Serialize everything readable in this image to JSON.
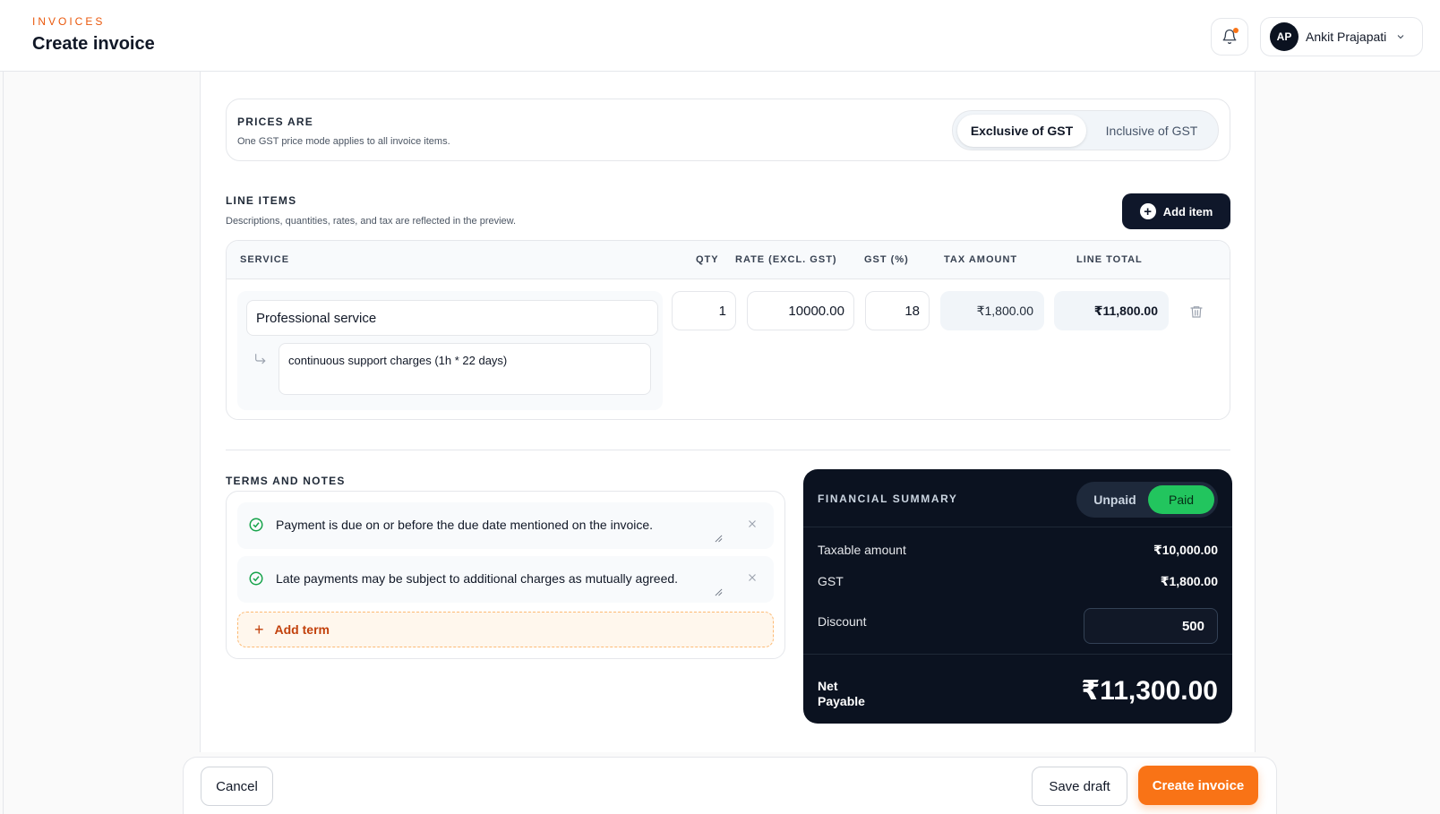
{
  "header": {
    "eyebrow": "INVOICES",
    "title": "Create invoice",
    "user": {
      "initials": "AP",
      "name": "Ankit Prajapati"
    }
  },
  "prices": {
    "title": "PRICES ARE",
    "subtitle": "One GST price mode applies to all invoice items.",
    "options": [
      "Exclusive of GST",
      "Inclusive of GST"
    ],
    "selected": "Exclusive of GST"
  },
  "line_items": {
    "title": "LINE ITEMS",
    "subtitle": "Descriptions, quantities, rates, and tax are reflected in the preview.",
    "add_label": "Add item",
    "columns": [
      "SERVICE",
      "QTY",
      "RATE (EXCL. GST)",
      "GST (%)",
      "TAX AMOUNT",
      "LINE TOTAL"
    ],
    "rows": [
      {
        "service": "Professional service",
        "description": "continuous support charges (1h * 22 days)",
        "qty": "1",
        "rate": "10000.00",
        "gst": "18",
        "tax_amount": "₹1,800.00",
        "line_total": "₹11,800.00"
      }
    ]
  },
  "terms": {
    "title": "TERMS AND NOTES",
    "items": [
      "Payment is due on or before the due date mentioned on the invoice.",
      "Late payments may be subject to additional charges as mutually agreed."
    ],
    "add_label": "Add term"
  },
  "summary": {
    "title": "FINANCIAL SUMMARY",
    "status_options": [
      "Unpaid",
      "Paid"
    ],
    "status_selected": "Paid",
    "taxable_label": "Taxable amount",
    "taxable_value": "₹10,000.00",
    "gst_label": "GST",
    "gst_value": "₹1,800.00",
    "discount_label": "Discount",
    "discount_value": "500",
    "net_label": "Net Payable",
    "net_value": "₹11,300.00"
  },
  "footer": {
    "cancel": "Cancel",
    "save_draft": "Save draft",
    "create": "Create invoice"
  },
  "colors": {
    "accent": "#f97316",
    "dark": "#0b1220",
    "paid": "#22c55e"
  }
}
